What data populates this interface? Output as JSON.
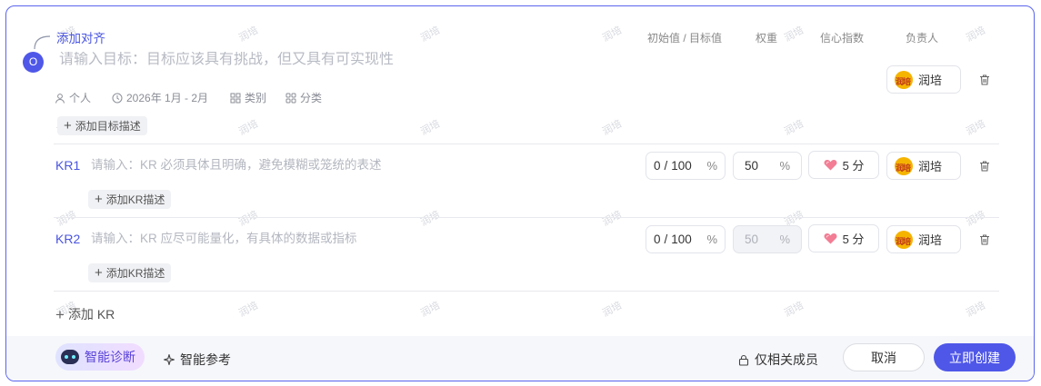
{
  "objective": {
    "align_link": "添加对齐",
    "badge": "O",
    "placeholder": "请输入目标：目标应该具有挑战，但又具有可实现性",
    "meta": {
      "owner_type": "个人",
      "period": "2026年 1月 - 2月",
      "category_type": "类别",
      "classification": "分类"
    },
    "add_desc": "添加目标描述",
    "owner": "润培"
  },
  "columns": {
    "initial_target": "初始值 / 目标值",
    "weight": "权重",
    "confidence": "信心指数",
    "owner": "负责人"
  },
  "key_results": [
    {
      "label": "KR1",
      "placeholder": "请输入：KR 必须具体且明确，避免模糊或笼统的表述",
      "initial": "0",
      "separator": "/",
      "target": "100",
      "unit": "%",
      "weight": "50",
      "weight_unit": "%",
      "weight_disabled": false,
      "confidence": "5 分",
      "owner": "润培",
      "add_desc": "添加KR描述"
    },
    {
      "label": "KR2",
      "placeholder": "请输入：KR 应尽可能量化，有具体的数据或指标",
      "initial": "0",
      "separator": "/",
      "target": "100",
      "unit": "%",
      "weight": "50",
      "weight_unit": "%",
      "weight_disabled": true,
      "confidence": "5 分",
      "owner": "润培",
      "add_desc": "添加KR描述"
    }
  ],
  "add_kr": "添加 KR",
  "footer": {
    "smart_diagnosis": "智能诊断",
    "smart_reference": "智能参考",
    "visibility": "仅相关成员",
    "cancel": "取消",
    "create": "立即创建"
  },
  "watermark_text": "润培",
  "colors": {
    "accent": "#4f57e8",
    "border": "#5a64ee",
    "link": "#4a55e0"
  }
}
